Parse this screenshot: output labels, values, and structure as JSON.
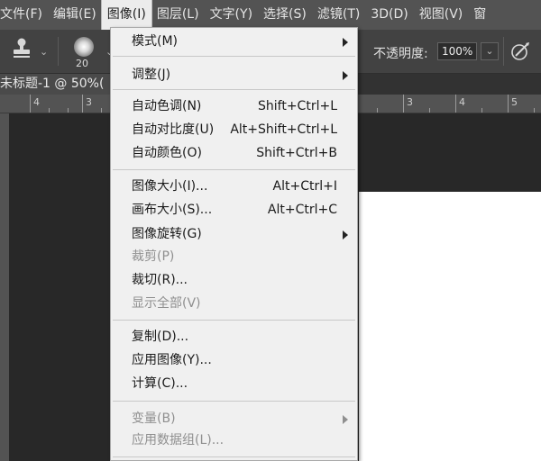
{
  "menubar": {
    "items": [
      {
        "label": "文件(F)"
      },
      {
        "label": "编辑(E)"
      },
      {
        "label": "图像(I)"
      },
      {
        "label": "图层(L)"
      },
      {
        "label": "文字(Y)"
      },
      {
        "label": "选择(S)"
      },
      {
        "label": "滤镜(T)"
      },
      {
        "label": "3D(D)"
      },
      {
        "label": "视图(V)"
      },
      {
        "label": "窗"
      }
    ]
  },
  "options": {
    "brush_size": "20",
    "opacity_label": "不透明度:",
    "opacity_value": "100%"
  },
  "document": {
    "tab_title": "未标题-1 @ 50%("
  },
  "ruler": {
    "labels": [
      "4",
      "3",
      "3",
      "4",
      "5"
    ]
  },
  "image_menu": {
    "items": [
      {
        "label": "模式(M)",
        "shortcut": "",
        "submenu": true,
        "enabled": true
      },
      {
        "label": "调整(J)",
        "shortcut": "",
        "submenu": true,
        "enabled": true
      },
      {
        "label": "自动色调(N)",
        "shortcut": "Shift+Ctrl+L",
        "submenu": false,
        "enabled": true
      },
      {
        "label": "自动对比度(U)",
        "shortcut": "Alt+Shift+Ctrl+L",
        "submenu": false,
        "enabled": true
      },
      {
        "label": "自动颜色(O)",
        "shortcut": "Shift+Ctrl+B",
        "submenu": false,
        "enabled": true
      },
      {
        "label": "图像大小(I)...",
        "shortcut": "Alt+Ctrl+I",
        "submenu": false,
        "enabled": true
      },
      {
        "label": "画布大小(S)...",
        "shortcut": "Alt+Ctrl+C",
        "submenu": false,
        "enabled": true
      },
      {
        "label": "图像旋转(G)",
        "shortcut": "",
        "submenu": true,
        "enabled": true
      },
      {
        "label": "裁剪(P)",
        "shortcut": "",
        "submenu": false,
        "enabled": false
      },
      {
        "label": "裁切(R)...",
        "shortcut": "",
        "submenu": false,
        "enabled": true
      },
      {
        "label": "显示全部(V)",
        "shortcut": "",
        "submenu": false,
        "enabled": false
      },
      {
        "label": "复制(D)...",
        "shortcut": "",
        "submenu": false,
        "enabled": true
      },
      {
        "label": "应用图像(Y)...",
        "shortcut": "",
        "submenu": false,
        "enabled": true
      },
      {
        "label": "计算(C)...",
        "shortcut": "",
        "submenu": false,
        "enabled": true
      },
      {
        "label": "变量(B)",
        "shortcut": "",
        "submenu": true,
        "enabled": false
      },
      {
        "label": "应用数据组(L)...",
        "shortcut": "",
        "submenu": false,
        "enabled": false
      }
    ]
  },
  "colors": {
    "menubar_bg": "#535353",
    "options_bg": "#424242",
    "workspace_bg": "#282828",
    "menu_bg": "#f0f0f0",
    "disabled_text": "#8f8f8f"
  }
}
